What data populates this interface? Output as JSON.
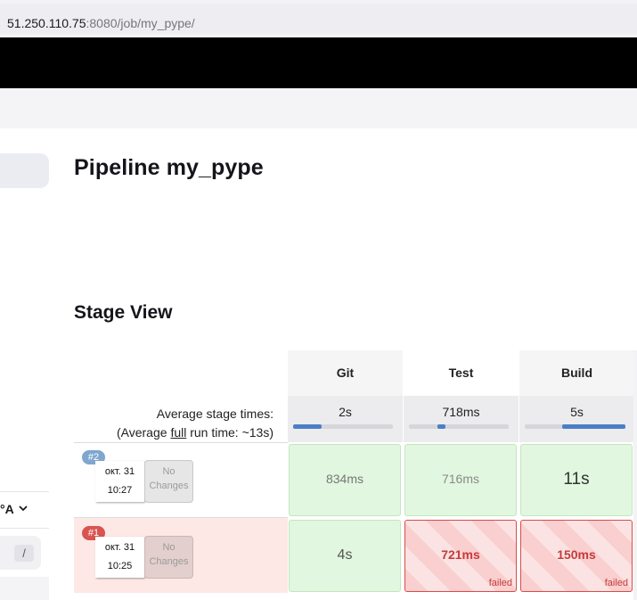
{
  "browser": {
    "url_host": "51.250.110.75",
    "url_rest": ":8080/job/my_pype/"
  },
  "sidebar": {
    "branch_label": "°A",
    "slash_label": "/"
  },
  "page_title": "Pipeline my_pype",
  "stage_view": {
    "title": "Stage View",
    "avg_label_line1": "Average stage times:",
    "avg_label_line2_prefix": "(Average ",
    "avg_label_line2_link": "full",
    "avg_label_line2_suffix": " run time: ~13s)",
    "stages": [
      {
        "name": "Git",
        "avg": "2s",
        "progress": 0.29
      },
      {
        "name": "Test",
        "avg": "718ms",
        "progress": 0.08
      },
      {
        "name": "Build",
        "avg": "5s",
        "progress": 0.63
      }
    ],
    "runs": [
      {
        "number": "#2",
        "badge_color": "#7fa6cf",
        "date": "окт. 31",
        "time": "10:27",
        "changes_line1": "No",
        "changes_line2": "Changes",
        "status": "success",
        "cells": [
          {
            "value": "834ms",
            "status": "success"
          },
          {
            "value": "716ms",
            "status": "success"
          },
          {
            "value": "11s",
            "status": "success"
          }
        ]
      },
      {
        "number": "#1",
        "badge_color": "#d9534f",
        "date": "окт. 31",
        "time": "10:25",
        "changes_line1": "No",
        "changes_line2": "Changes",
        "status": "failed",
        "cells": [
          {
            "value": "4s",
            "status": "success"
          },
          {
            "value": "721ms",
            "status": "failed",
            "status_label": "failed"
          },
          {
            "value": "150ms",
            "status": "failed",
            "status_label": "failed"
          }
        ]
      }
    ]
  },
  "colors": {
    "success_bg": "#e1f7df",
    "failed_border": "#d74c4c",
    "failed_row_bg": "#fde8e6",
    "progress_fill": "#4a7fc8"
  }
}
